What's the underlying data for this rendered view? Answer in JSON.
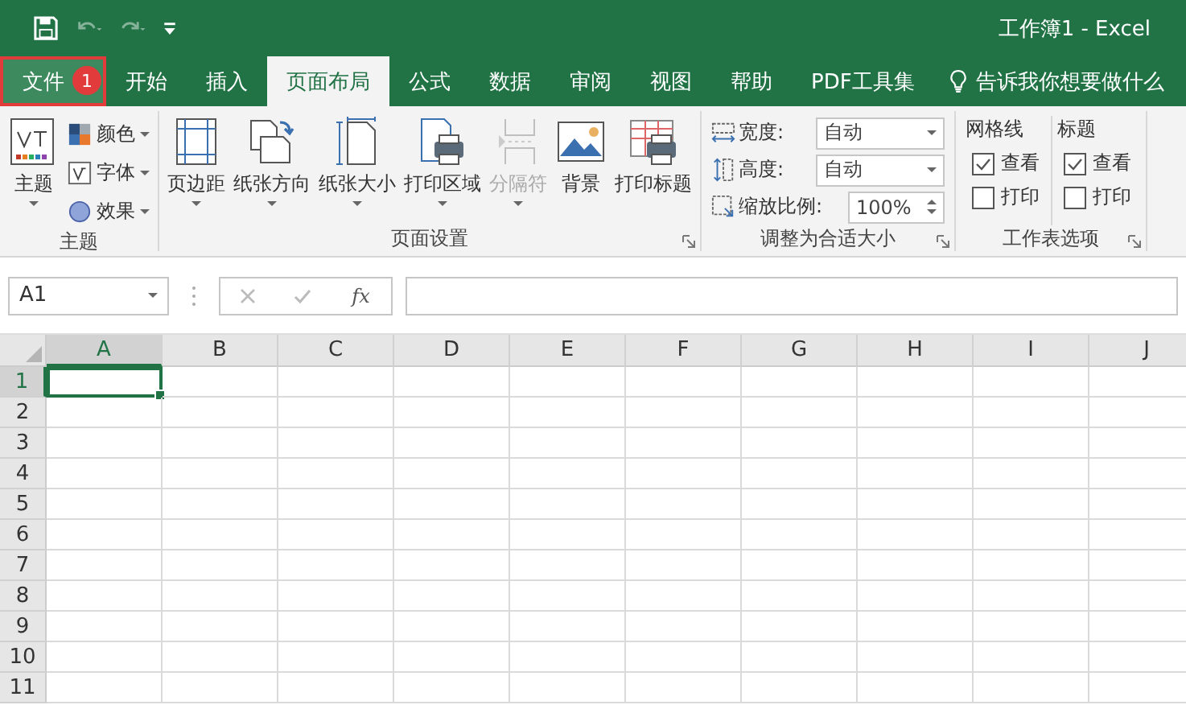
{
  "title_bar": {
    "title": "工作簿1  -  Excel"
  },
  "quick_access": [
    {
      "kind": "save",
      "disabled": false
    },
    {
      "kind": "undo",
      "disabled": true
    },
    {
      "kind": "redo",
      "disabled": true
    },
    {
      "kind": "customize",
      "disabled": false
    }
  ],
  "tabs": [
    {
      "label": "文件",
      "selected": false,
      "highlighted": true,
      "badge": "1"
    },
    {
      "label": "开始",
      "selected": false,
      "highlighted": false
    },
    {
      "label": "插入",
      "selected": false,
      "highlighted": false
    },
    {
      "label": "页面布局",
      "selected": true,
      "highlighted": false
    },
    {
      "label": "公式",
      "selected": false,
      "highlighted": false
    },
    {
      "label": "数据",
      "selected": false,
      "highlighted": false
    },
    {
      "label": "审阅",
      "selected": false,
      "highlighted": false
    },
    {
      "label": "视图",
      "selected": false,
      "highlighted": false
    },
    {
      "label": "帮助",
      "selected": false,
      "highlighted": false
    },
    {
      "label": "PDF工具集",
      "selected": false,
      "highlighted": false
    }
  ],
  "tell_me": "告诉我你想要做什么",
  "ribbon": {
    "groups": [
      {
        "kind": "buttons",
        "label": "主题",
        "launcher": false,
        "items": [
          {
            "kind": "large",
            "label": "主题",
            "dropdown": true,
            "disabled": false
          },
          {
            "kind": "small",
            "label": "颜色",
            "dropdown": true,
            "disabled": false
          },
          {
            "kind": "small",
            "label": "字体",
            "dropdown": true,
            "disabled": false
          },
          {
            "kind": "small",
            "label": "效果",
            "dropdown": true,
            "disabled": false
          }
        ]
      },
      {
        "kind": "buttons",
        "label": "页面设置",
        "launcher": true,
        "items": [
          {
            "kind": "large",
            "label": "页边距",
            "dropdown": true,
            "disabled": false
          },
          {
            "kind": "large",
            "label": "纸张方向",
            "dropdown": true,
            "disabled": false
          },
          {
            "kind": "large",
            "label": "纸张大小",
            "dropdown": true,
            "disabled": false
          },
          {
            "kind": "large",
            "label": "打印区域",
            "dropdown": true,
            "disabled": false
          },
          {
            "kind": "large",
            "label": "分隔符",
            "dropdown": true,
            "disabled": true
          },
          {
            "kind": "large",
            "label": "背景",
            "dropdown": false,
            "disabled": false
          },
          {
            "kind": "large",
            "label": "打印标题",
            "dropdown": false,
            "disabled": false
          }
        ]
      },
      {
        "kind": "scale",
        "label": "调整为合适大小",
        "launcher": true,
        "rows": [
          {
            "kind": "dropdown",
            "label": "宽度:",
            "value": "自动"
          },
          {
            "kind": "dropdown",
            "label": "高度:",
            "value": "自动"
          },
          {
            "kind": "spin",
            "label": "缩放比例:",
            "value": "100%"
          }
        ]
      },
      {
        "kind": "options",
        "label": "工作表选项",
        "launcher": true,
        "columns": [
          {
            "heading": "网格线",
            "checks": [
              {
                "label": "查看",
                "checked": true
              },
              {
                "label": "打印",
                "checked": false
              }
            ]
          },
          {
            "heading": "标题",
            "checks": [
              {
                "label": "查看",
                "checked": true
              },
              {
                "label": "打印",
                "checked": false
              }
            ]
          }
        ]
      }
    ]
  },
  "formula_bar": {
    "name_box": "A1",
    "function_label": "fx"
  },
  "sheet": {
    "columns": [
      {
        "label": "A",
        "selected": true
      },
      {
        "label": "B",
        "selected": false
      },
      {
        "label": "C",
        "selected": false
      },
      {
        "label": "D",
        "selected": false
      },
      {
        "label": "E",
        "selected": false
      },
      {
        "label": "F",
        "selected": false
      },
      {
        "label": "G",
        "selected": false
      },
      {
        "label": "H",
        "selected": false
      },
      {
        "label": "I",
        "selected": false
      },
      {
        "label": "J",
        "selected": false
      }
    ],
    "rows": [
      {
        "label": "1",
        "selected": true
      },
      {
        "label": "2",
        "selected": false
      },
      {
        "label": "3",
        "selected": false
      },
      {
        "label": "4",
        "selected": false
      },
      {
        "label": "5",
        "selected": false
      },
      {
        "label": "6",
        "selected": false
      },
      {
        "label": "7",
        "selected": false
      },
      {
        "label": "8",
        "selected": false
      },
      {
        "label": "9",
        "selected": false
      },
      {
        "label": "10",
        "selected": false
      },
      {
        "label": "11",
        "selected": false
      }
    ]
  }
}
